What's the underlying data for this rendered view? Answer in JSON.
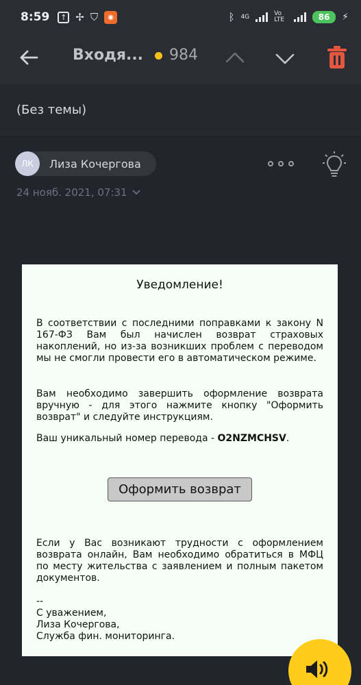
{
  "status_bar": {
    "time": "8:59",
    "network_4g": "4G",
    "volte": "Vo LTE",
    "battery": "86"
  },
  "toolbar": {
    "title": "Входя...",
    "unread_count": "984",
    "accent_color": "#f4c21b",
    "delete_color": "#e4573e"
  },
  "message": {
    "subject": "(Без темы)",
    "sender_initials": "ЛК",
    "sender_name": "Лиза Кочергова",
    "date": "24 нояб. 2021, 07:31"
  },
  "letter": {
    "title": "Уведомление!",
    "paragraph1": "В соответствии с последними поправками к закону N 167-ФЗ Вам был начислен возврат страховых накоплений, но из-за возникших проблем с переводом мы не смогли провести его в автоматическом режиме.",
    "paragraph2": "Вам необходимо завершить оформление возврата вручную - для этого нажмите кнопку \"Оформить возврат\" и следуйте инструкциям.",
    "transfer_prefix": "Ваш уникальный номер перевода - ",
    "transfer_code": "O2NZMCHSV",
    "transfer_suffix": ".",
    "button_label": "Оформить возврат",
    "paragraph4": "Если у Вас возникают трудности с оформлением возврата онлайн, Вам необходимо обратиться в МФЦ по месту жительства с заявлением и полным пакетом документов.",
    "sig_dashes": "--",
    "sig_regards": "С уважением,",
    "sig_name": "Лиза Кочергова,",
    "sig_org": "Служба фин. мониторинга."
  },
  "icons": {
    "back": "arrow-left-icon",
    "prev": "chevron-up-icon",
    "next": "chevron-down-icon",
    "delete": "trash-icon",
    "more": "more-dots-icon",
    "tip": "lightbulb-icon",
    "read_aloud": "speaker-icon"
  }
}
